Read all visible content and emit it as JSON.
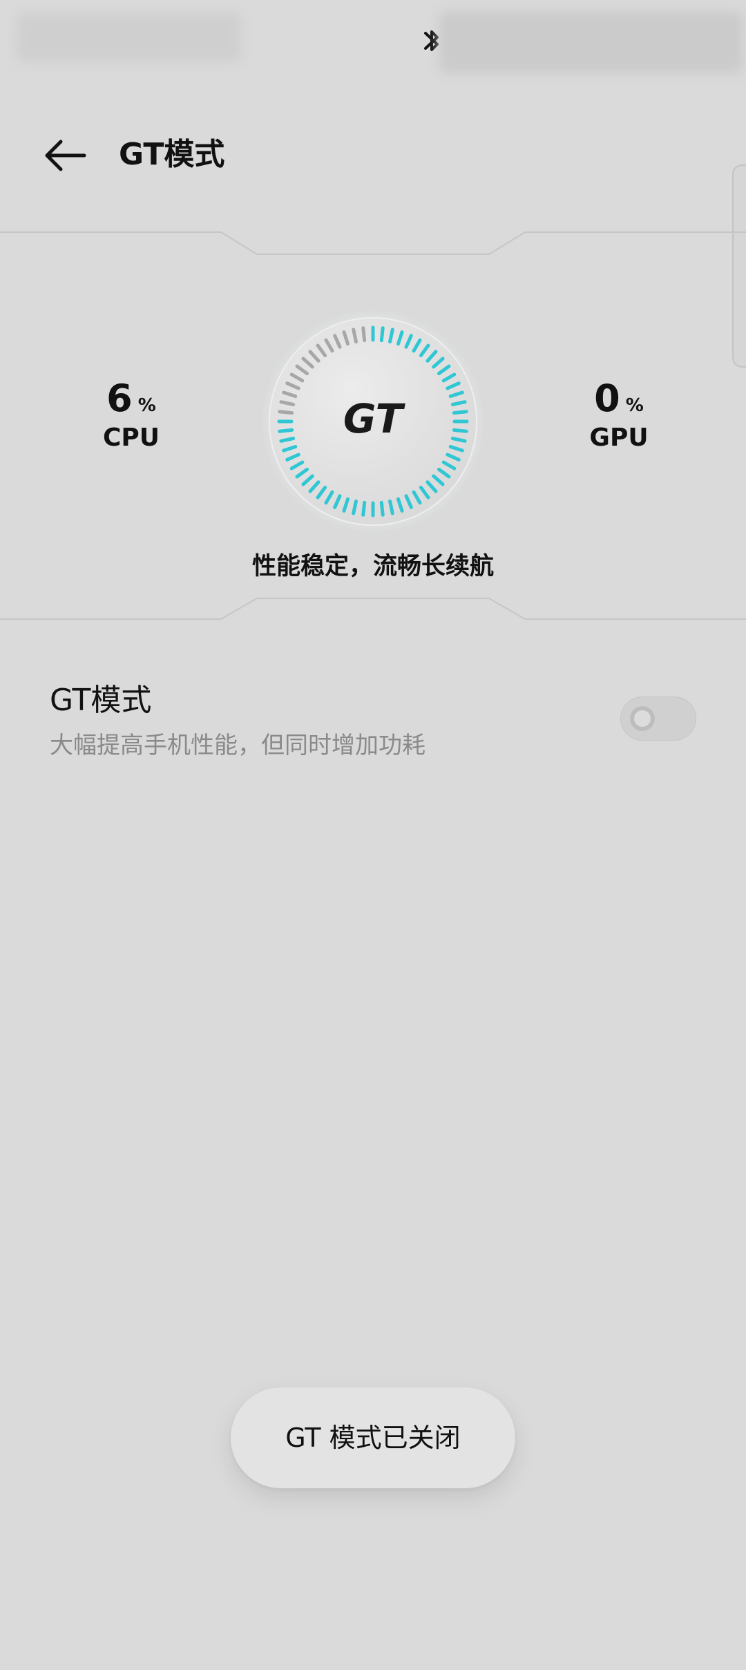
{
  "header": {
    "title": "GT模式"
  },
  "stats": {
    "cpu": {
      "value": "6",
      "unit": "%",
      "label": "CPU"
    },
    "gpu": {
      "value": "0",
      "unit": "%",
      "label": "GPU"
    }
  },
  "gauge": {
    "logo_text": "GT",
    "active_color": "#2fc7d3",
    "inactive_color": "#a7a7a7"
  },
  "status_tagline": "性能稳定，流畅长续航",
  "setting": {
    "title": "GT模式",
    "description": "大幅提高手机性能，但同时增加功耗",
    "enabled": false
  },
  "toast": {
    "text": "GT 模式已关闭"
  },
  "icons": {
    "back": "arrow-left-icon",
    "bluetooth": "bluetooth-icon"
  }
}
